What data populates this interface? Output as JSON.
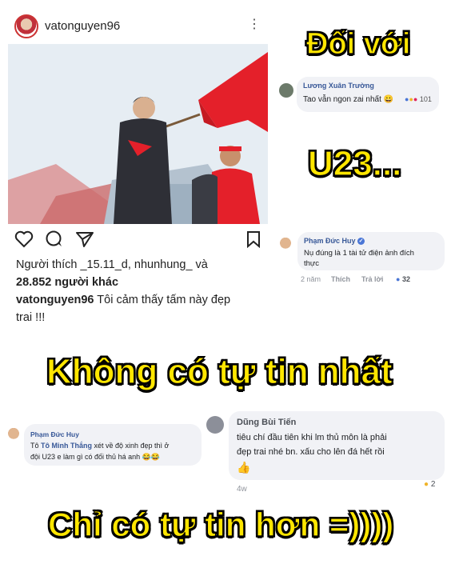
{
  "instagram": {
    "username": "vatonguyen96",
    "likes_line1": "Người thích _15.11_d, nhunhung_ và",
    "likes_line2": "28.852 người khác",
    "caption_user": "vatonguyen96",
    "caption_text_1": " Tôi cảm thấy tấm này đẹp",
    "caption_text_2": "trai !!!"
  },
  "captions": {
    "c1": "Đối với",
    "c2": "U23...",
    "c3": "Không có tự tin nhất",
    "c4": "Chỉ có tự tin hơn =))))"
  },
  "comments": {
    "truong": {
      "name": "Lương Xuân Trường",
      "text": "Tao vẫn ngon zai nhất 😀",
      "count": "101"
    },
    "huy1": {
      "name": "Phạm Đức Huy",
      "text_1": "Nụ đúng là 1 tài tử điện ảnh đích",
      "text_2": "thực",
      "time": "2 năm",
      "like": "Thích",
      "reply": "Trả lời",
      "count": "32"
    },
    "huy2": {
      "name": "Phạm Đức Huy",
      "mention": "Tô Minh Thắng",
      "text_pre": "Tô ",
      "text_1": " xét về độ xinh đẹp thì ở",
      "text_2": "đội U23 e làm gì có đối thủ há anh 😂😂"
    },
    "dung": {
      "name": "Dũng Bùi Tiến",
      "text_1": "tiêu chí đầu tiên khi lm thủ môn là phải",
      "text_2": "đẹp trai nhé bn. xấu cho lên đá hết rồi",
      "emoji": "👍",
      "time": "4w",
      "count": "2"
    }
  },
  "colors": {
    "caption_fill": "#ffe600",
    "caption_stroke": "#000000",
    "flag_red": "#e4202a",
    "name_blue": "#385898"
  },
  "icons": [
    "heart-icon",
    "comment-icon",
    "share-icon",
    "bookmark-icon",
    "more-icon",
    "like-reaction-icon",
    "verified-icon"
  ]
}
